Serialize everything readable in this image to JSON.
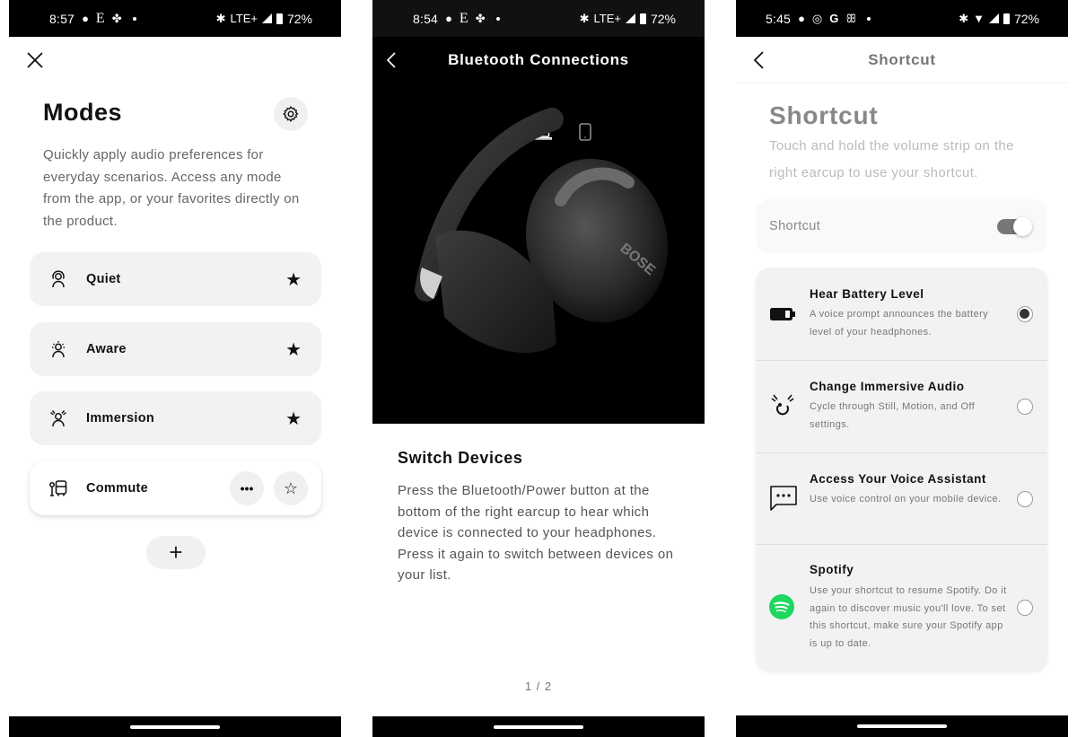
{
  "screens": [
    {
      "status_bar": {
        "time": "8:57",
        "notif_icons": [
          "message-icon",
          "e-app-icon",
          "pinwheel-icon"
        ],
        "network": "LTE+",
        "battery": "72%"
      },
      "close_label": "×",
      "title": "Modes",
      "description": "Quickly apply audio preferences for everyday scenarios. Access any mode from the app, or your favorites directly on the product.",
      "modes": [
        {
          "label": "Quiet",
          "icon": "quiet-mode-icon",
          "favorite": true
        },
        {
          "label": "Aware",
          "icon": "aware-mode-icon",
          "favorite": true
        },
        {
          "label": "Immersion",
          "icon": "immersion-mode-icon",
          "favorite": true
        },
        {
          "label": "Commute",
          "icon": "commute-mode-icon",
          "favorite": false,
          "active": true,
          "more_label": "•••"
        }
      ],
      "add_label": "+"
    },
    {
      "status_bar": {
        "time": "8:54",
        "notif_icons": [
          "message-icon",
          "e-app-icon",
          "pinwheel-icon"
        ],
        "network": "LTE+",
        "battery": "72%"
      },
      "header_title": "Bluetooth Connections",
      "device_icons": [
        "laptop-icon",
        "phone-icon"
      ],
      "media": "headphones-image",
      "section_title": "Switch Devices",
      "section_desc": "Press the Bluetooth/Power button at the bottom of the right earcup to hear which device is connected to your headphones. Press it again to switch between devices on your list.",
      "pager": "1 / 2"
    },
    {
      "status_bar": {
        "time": "5:45",
        "notif_icons": [
          "message-icon",
          "whatsapp-icon",
          "google-icon",
          "people-icon"
        ],
        "network": "wifi",
        "battery": "72%"
      },
      "header_title": "Shortcut",
      "title": "Shortcut",
      "description": "Touch and hold the volume strip on the right earcup to use your shortcut.",
      "toggle": {
        "label": "Shortcut",
        "on": true
      },
      "options": [
        {
          "title": "Hear Battery Level",
          "desc": "A voice prompt announces the battery level of your headphones.",
          "icon": "battery-icon",
          "selected": true
        },
        {
          "title": "Change Immersive Audio",
          "desc": "Cycle through Still, Motion, and Off settings.",
          "icon": "immersive-audio-icon",
          "selected": false
        },
        {
          "title": "Access Your Voice Assistant",
          "desc": "Use voice control on your mobile device.",
          "icon": "voice-assistant-icon",
          "selected": false
        },
        {
          "title": "Spotify",
          "desc": "Use your shortcut to resume Spotify. Do it again to discover music you'll love. To set this shortcut, make sure your Spotify app is up to date.",
          "icon": "spotify-icon",
          "selected": false
        }
      ]
    }
  ],
  "colors": {
    "spotify_green": "#1ed760",
    "card_bg": "#f2f2f2",
    "status_bar": "#000000"
  }
}
